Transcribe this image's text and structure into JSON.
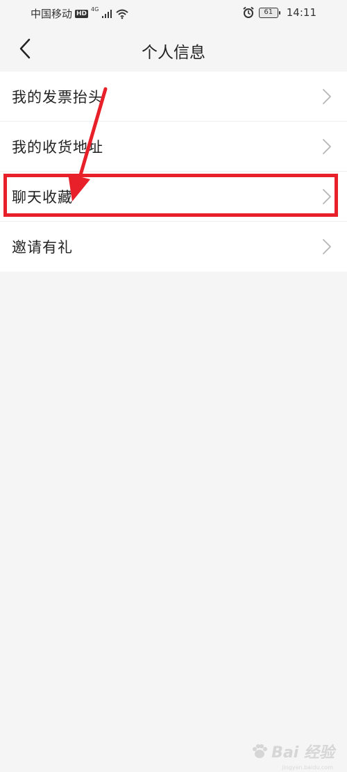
{
  "status_bar": {
    "carrier": "中国移动",
    "hd_badge": "HD",
    "network_type": "4G",
    "battery_level": "61",
    "time": "14:11",
    "icons": [
      "signal-icon",
      "wifi-icon",
      "alarm-icon",
      "battery-icon"
    ]
  },
  "nav": {
    "title": "个人信息",
    "back_icon": "chevron-left-icon"
  },
  "list": {
    "items": [
      {
        "label": "我的发票抬头"
      },
      {
        "label": "我的收货地址"
      },
      {
        "label": "聊天收藏"
      },
      {
        "label": "邀请有礼"
      }
    ]
  },
  "annotation": {
    "highlight_color": "#e8202a",
    "highlighted_item": "聊天收藏"
  },
  "watermark": {
    "brand": "Bai 经验",
    "url": "jingyan.baidu.com"
  }
}
